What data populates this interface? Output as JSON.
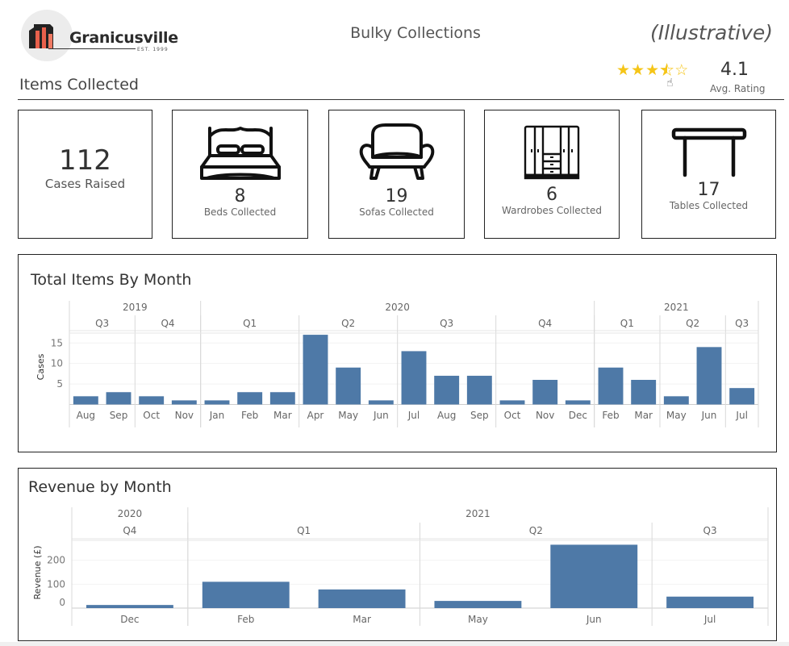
{
  "header": {
    "logo_name": "Granicusville",
    "logo_est": "EST. 1999",
    "title": "Bulky Collections",
    "tag": "(Illustrative)"
  },
  "rating": {
    "value": "4.1",
    "label": "Avg. Rating",
    "stars_filled": 3.5,
    "stars_total": 5,
    "star_color": "#f5c518"
  },
  "section": {
    "title": "Items Collected"
  },
  "kpis": [
    {
      "value": "112",
      "label": "Cases Raised",
      "icon": "none"
    },
    {
      "value": "8",
      "label": "Beds Collected",
      "icon": "bed-icon"
    },
    {
      "value": "19",
      "label": "Sofas Collected",
      "icon": "sofa-icon"
    },
    {
      "value": "6",
      "label": "Wardrobes Collected",
      "icon": "wardrobe-icon"
    },
    {
      "value": "17",
      "label": "Tables Collected",
      "icon": "table-icon"
    }
  ],
  "colors": {
    "bar": "#4e79a7",
    "grid": "#eeeeee",
    "divider": "#d9d9d9"
  },
  "chart_data": [
    {
      "type": "bar",
      "title": "Total Items By Month",
      "xlabel": "",
      "ylabel": "Cases",
      "ylim": [
        0,
        18
      ],
      "yticks": [
        5,
        10,
        15
      ],
      "grid": true,
      "years": [
        {
          "label": "2019",
          "span": 4
        },
        {
          "label": "2020",
          "span": 12
        },
        {
          "label": "2021",
          "span": 5
        }
      ],
      "quarters": [
        {
          "label": "Q3",
          "span": 2
        },
        {
          "label": "Q4",
          "span": 2
        },
        {
          "label": "Q1",
          "span": 3
        },
        {
          "label": "Q2",
          "span": 3
        },
        {
          "label": "Q3",
          "span": 3
        },
        {
          "label": "Q4",
          "span": 3
        },
        {
          "label": "Q1",
          "span": 2
        },
        {
          "label": "Q2",
          "span": 2
        },
        {
          "label": "Q3",
          "span": 1
        }
      ],
      "categories": [
        "Aug",
        "Sep",
        "Oct",
        "Nov",
        "Jan",
        "Feb",
        "Mar",
        "Apr",
        "May",
        "Jun",
        "Jul",
        "Aug",
        "Sep",
        "Oct",
        "Nov",
        "Dec",
        "Feb",
        "Mar",
        "May",
        "Jun",
        "Jul"
      ],
      "values": [
        2,
        3,
        2,
        1,
        1,
        3,
        3,
        17,
        9,
        1,
        13,
        7,
        7,
        1,
        6,
        1,
        9,
        6,
        2,
        14,
        4
      ]
    },
    {
      "type": "bar",
      "title": "Revenue by Month",
      "xlabel": "",
      "ylabel": "Revenue (£)",
      "ylim": [
        0,
        290
      ],
      "yticks": [
        0,
        100,
        200
      ],
      "grid": true,
      "years": [
        {
          "label": "2020",
          "span": 1
        },
        {
          "label": "2021",
          "span": 5
        }
      ],
      "quarters": [
        {
          "label": "Q4",
          "span": 1
        },
        {
          "label": "Q1",
          "span": 2
        },
        {
          "label": "Q2",
          "span": 2
        },
        {
          "label": "Q3",
          "span": 1
        }
      ],
      "categories": [
        "Dec",
        "Feb",
        "Mar",
        "May",
        "Jun",
        "Jul"
      ],
      "values": [
        13,
        110,
        78,
        30,
        265,
        48
      ]
    }
  ]
}
